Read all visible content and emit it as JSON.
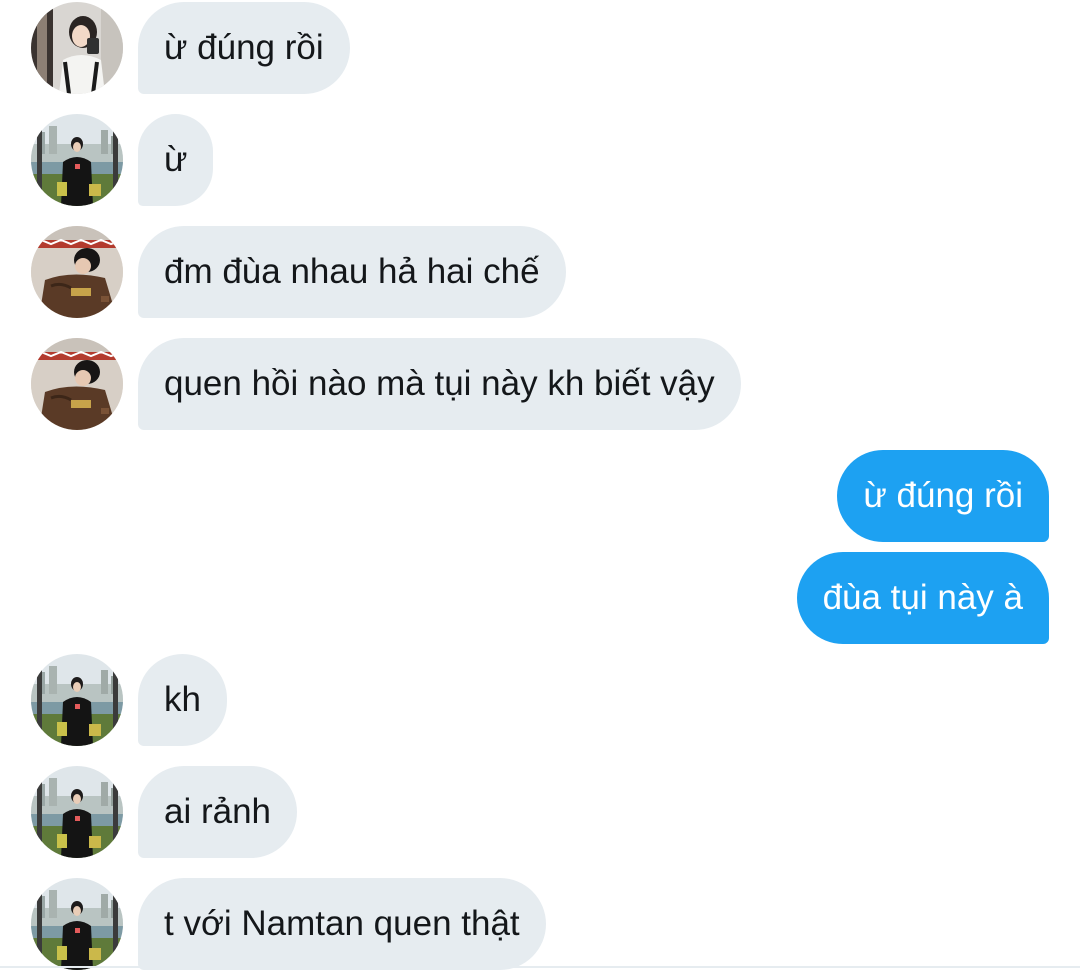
{
  "messages": [
    {
      "id": "m1",
      "direction": "in",
      "avatar": "avatar-girl-mirror",
      "text": "ừ đúng rồi"
    },
    {
      "id": "m2",
      "direction": "in",
      "avatar": "avatar-riverside",
      "text": "ừ"
    },
    {
      "id": "m3",
      "direction": "in",
      "avatar": "avatar-brown-jacket",
      "text": "đm đùa nhau hả hai chế"
    },
    {
      "id": "m4",
      "direction": "in",
      "avatar": "avatar-brown-jacket",
      "text": "quen hồi nào mà tụi này kh biết vậy"
    },
    {
      "id": "m5",
      "direction": "out",
      "text": "ừ đúng rồi"
    },
    {
      "id": "m6",
      "direction": "out",
      "text": "đùa tụi này à"
    },
    {
      "id": "m7",
      "direction": "in",
      "avatar": "avatar-riverside",
      "text": "kh"
    },
    {
      "id": "m8",
      "direction": "in",
      "avatar": "avatar-riverside",
      "text": "ai rảnh"
    },
    {
      "id": "m9",
      "direction": "in",
      "avatar": "avatar-riverside",
      "text": "t với Namtan quen thật"
    }
  ],
  "colors": {
    "incoming_bubble": "#e6ecf0",
    "outgoing_bubble": "#1da1f2",
    "incoming_text": "#14171a",
    "outgoing_text": "#ffffff"
  }
}
